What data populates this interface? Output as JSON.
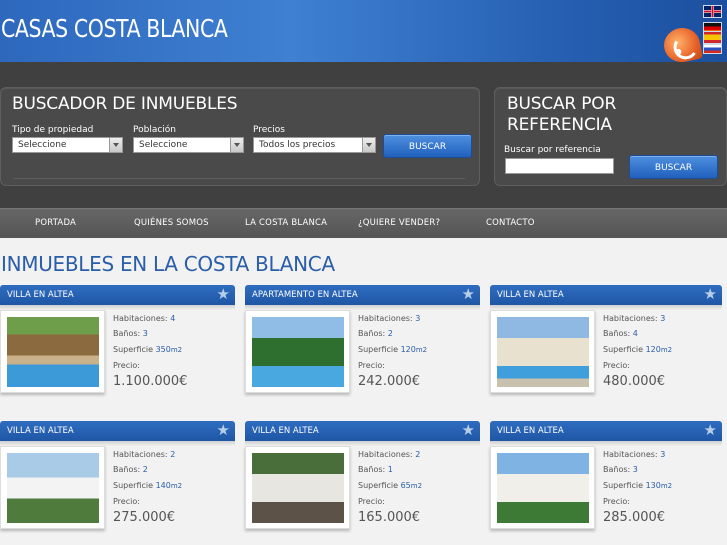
{
  "header": {
    "logo": "CASAS COSTA BLANCA",
    "flags": [
      "english-flag",
      "german-flag",
      "spanish-flag",
      "russian-flag"
    ]
  },
  "search": {
    "title": "BUSCADOR DE INMUEBLES",
    "type_label": "Tipo de propiedad",
    "type_value": "Seleccione",
    "town_label": "Población",
    "town_value": "Seleccione",
    "price_label": "Precios",
    "price_value": "Todos los precios",
    "button": "BUSCAR"
  },
  "ref_search": {
    "title": "BUSCAR POR REFERENCIA",
    "label": "Buscar por referencia",
    "value": "",
    "button": "BUSCAR"
  },
  "nav": [
    "PORTADA",
    "QUIÉNES SOMOS",
    "LA COSTA BLANCA",
    "¿QUIERE VENDER?",
    "CONTACTO"
  ],
  "main": {
    "title": "INMUEBLES EN LA COSTA BLANCA",
    "labels": {
      "rooms": "Habitaciones:",
      "baths": "Baños:",
      "area": "Superficie",
      "unit": "m2",
      "price": "Precio:"
    },
    "properties": [
      {
        "title": "VILLA EN ALTEA",
        "rooms": "4",
        "baths": "3",
        "area": "350",
        "price": "1.100.000€"
      },
      {
        "title": "APARTAMENTO EN ALTEA",
        "rooms": "3",
        "baths": "2",
        "area": "120",
        "price": "242.000€"
      },
      {
        "title": "VILLA EN ALTEA",
        "rooms": "3",
        "baths": "4",
        "area": "120",
        "price": "480.000€"
      },
      {
        "title": "VILLA EN ALTEA",
        "rooms": "2",
        "baths": "2",
        "area": "140",
        "price": "275.000€"
      },
      {
        "title": "VILLA EN ALTEA",
        "rooms": "2",
        "baths": "1",
        "area": "65",
        "price": "165.000€"
      },
      {
        "title": "VILLA EN ALTEA",
        "rooms": "3",
        "baths": "3",
        "area": "130",
        "price": "285.000€"
      }
    ]
  },
  "colors": {
    "header_blue": "#3f80d2",
    "dark_band": "#404040",
    "accent_blue": "#2a5ea8"
  }
}
